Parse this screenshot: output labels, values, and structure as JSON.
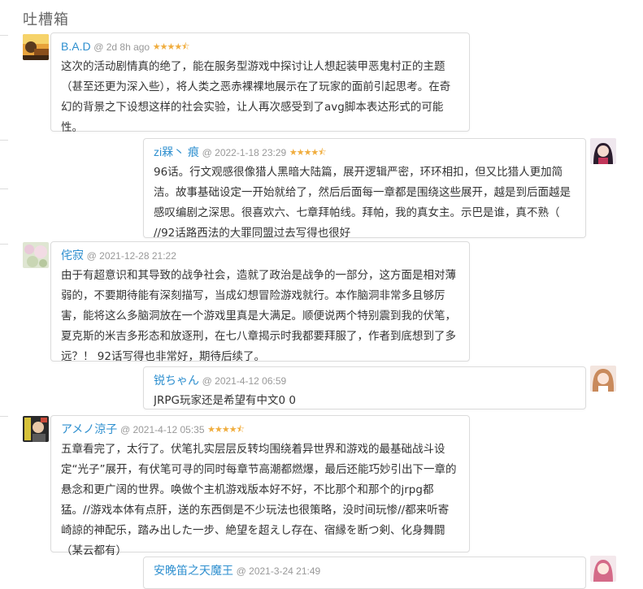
{
  "section": {
    "title": "吐槽箱"
  },
  "colors": {
    "username": "#2e8fcf",
    "stars": "#f0ad3e",
    "timestamp": "#999999"
  },
  "comments": [
    {
      "username": "B.A.D",
      "time": "2d 8h ago",
      "rating": 4.5,
      "stars_display": "★★★★⯪",
      "text": "这次的活动剧情真的绝了，能在服务型游戏中探讨让人想起装甲恶鬼村正的主题（甚至还更为深入些），将人类之恶赤裸裸地展示在了玩家的面前引起思考。在奇幻的背景之下设想这样的社会实验，让人再次感受到了avg脚本表达形式的可能性。"
    },
    {
      "username": "zi槑丶 痕",
      "time": "2022-1-18 23:29",
      "rating": 4.5,
      "stars_display": "★★★★⯪",
      "text": "96话。行文观感很像猎人黑暗大陆篇，展开逻辑严密，环环相扣，但又比猎人更加简洁。故事基础设定一开始就给了，然后后面每一章都是围绕这些展开，越是到后面越是感叹编剧之深思。很喜欢六、七章拜帕线。拜帕，我的真女主。示巴是谁，真不熟（ //92话路西法的大罪同盟过去写得也很好"
    },
    {
      "username": "侘寂",
      "time": "2021-12-28 21:22",
      "rating": 4.5,
      "stars_display": "★★★★⯪",
      "text": "由于有超意识和其导致的战争社会，造就了政治是战争的一部分，这方面是相对薄弱的，不要期待能有深刻描写，当成幻想冒险游戏就行。本作脑洞非常多且够厉害，能将这么多脑洞放在一个游戏里真是大满足。顺便说两个特别震到我的伏笔，夏克斯的米吉多形态和放逐刑，在七八章揭示时我都要拜服了，作者到底想到了多远？！ 92话写得也非常好，期待后续了。"
    },
    {
      "username": "锐ちゃん",
      "time": "2021-4-12 06:59",
      "text": "JRPG玩家还是希望有中文0 0"
    },
    {
      "username": "アメノ涼子",
      "time": "2021-4-12 05:35",
      "rating": 4.5,
      "stars_display": "★★★★⯪",
      "text": "五章看完了，太行了。伏笔扎实层层反转均围绕着异世界和游戏的最基础战斗设定“光子”展开，有伏笔可寻的同时每章节高潮都燃爆，最后还能巧妙引出下一章的悬念和更广阔的世界。唤做个主机游戏版本好不好，不比那个和那个的jrpg都猛。//游戏本体有点肝，送的东西倒是不少玩法也很策略，没时间玩惨//都来听寄崎諒的神配乐，踏み出した一步、絶望を超えし存在、宿縁を断つ剣、化身舞闘（某云都有）"
    },
    {
      "username": "安晚笛之天魔王",
      "time": "2021-3-24 21:49",
      "text": ""
    }
  ]
}
